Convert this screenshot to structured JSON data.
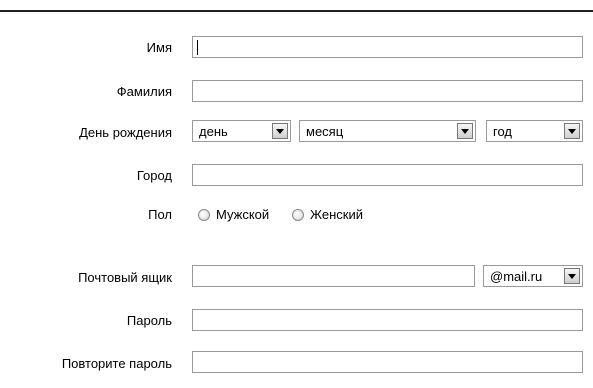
{
  "form": {
    "first_name": {
      "label": "Имя",
      "value": ""
    },
    "last_name": {
      "label": "Фамилия",
      "value": ""
    },
    "birthday": {
      "label": "День рождения",
      "day": "день",
      "month": "месяц",
      "year": "год"
    },
    "city": {
      "label": "Город",
      "value": ""
    },
    "gender": {
      "label": "Пол",
      "options": [
        "Мужской",
        "Женский"
      ]
    },
    "mailbox": {
      "label": "Почтовый ящик",
      "value": "",
      "domain": "@mail.ru"
    },
    "password": {
      "label": "Пароль",
      "value": ""
    },
    "password_repeat": {
      "label": "Повторите пароль",
      "value": ""
    }
  },
  "icons": {
    "dropdown": "triangle-down-icon",
    "radio": "radio-circle-icon"
  }
}
